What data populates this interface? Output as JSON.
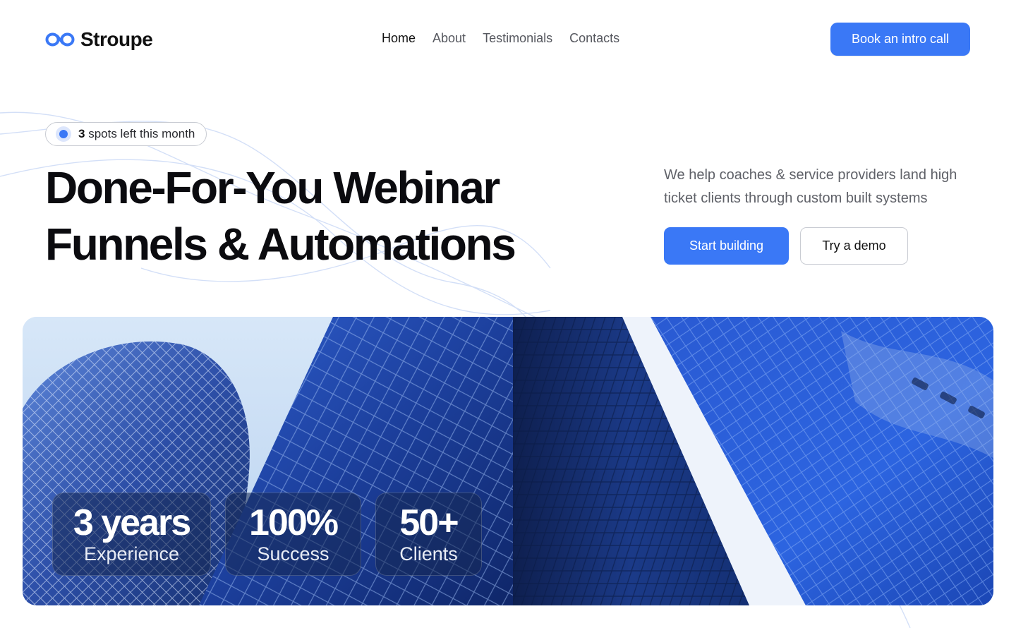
{
  "brand": {
    "name": "Stroupe",
    "logo_icon": "infinity-loop-icon",
    "accent": "#3a78f6"
  },
  "nav": {
    "items": [
      {
        "label": "Home",
        "active": true
      },
      {
        "label": "About",
        "active": false
      },
      {
        "label": "Testimonials",
        "active": false
      },
      {
        "label": "Contacts",
        "active": false
      }
    ],
    "cta_label": "Book an intro call"
  },
  "hero": {
    "badge": {
      "count": "3",
      "text": "spots left this month"
    },
    "headline_line1": "Done-For-You Webinar",
    "headline_line2": "Funnels & Automations",
    "subtext": "We help coaches & service providers land high ticket clients through custom built systems",
    "primary_cta": "Start building",
    "secondary_cta": "Try a demo"
  },
  "stats": [
    {
      "value": "3 years",
      "label": "Experience"
    },
    {
      "value": "100%",
      "label": "Success"
    },
    {
      "value": "50+",
      "label": "Clients"
    }
  ]
}
